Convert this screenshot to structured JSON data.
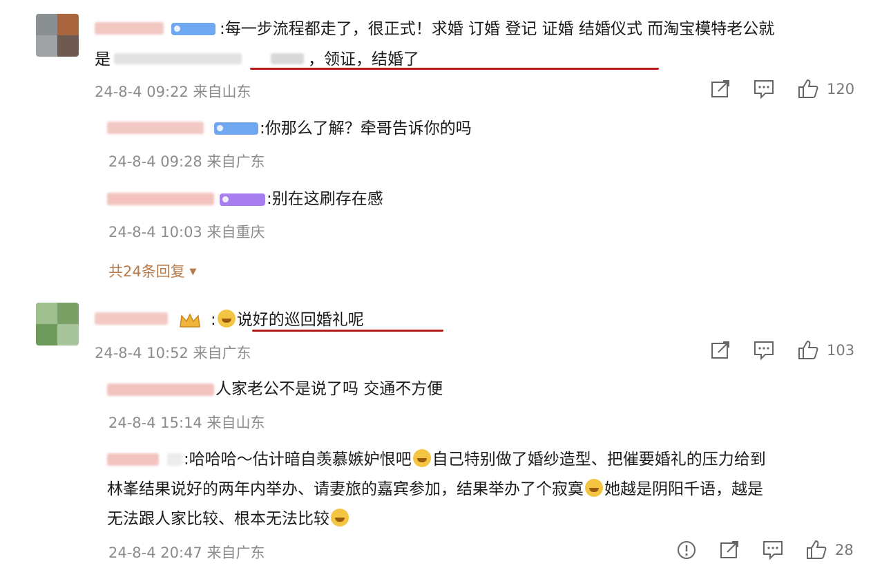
{
  "comments": [
    {
      "text_line1": ":每一步流程都走了，很正式！求婚 订婚 登记 证婚 结婚仪式 而淘宝模特老公就",
      "text_line2_prefix": "是",
      "text_line2_suffix": "，领证，结婚了",
      "timestamp": "24-8-4 09:22 来自山东",
      "likes": "120"
    },
    {
      "text": "说好的巡回婚礼呢",
      "timestamp": "24-8-4 10:52 来自广东",
      "likes": "103"
    }
  ],
  "replies": [
    {
      "text": ":你那么了解？牵哥告诉你的吗",
      "timestamp": "24-8-4 09:28 来自广东"
    },
    {
      "text": ":别在这刷存在感",
      "timestamp": "24-8-4 10:03 来自重庆"
    },
    {
      "text": "人家老公不是说了吗 交通不方便",
      "timestamp": "24-8-4 15:14 来自山东"
    },
    {
      "line1_a": ":哈哈哈～估计暗自羡慕嫉妒恨吧",
      "line1_b": "自己特别做了婚纱造型、把催要婚礼的压力给到",
      "line2_a": "林峯结果说好的两年内举办、请妻旅的嘉宾参加，结果举办了个寂寞",
      "line2_b": "她越是阴阳千语，越是",
      "line3": "无法跟人家比较、根本无法比较",
      "timestamp": "24-8-4 20:47 来自广东",
      "likes": "28"
    }
  ],
  "more_replies": "共24条回复",
  "colors": {
    "underline": "#b51a1a",
    "badge_blue": "#6fa8f0",
    "badge_purple": "#a77ef0",
    "more_link": "#b77a4a"
  },
  "icons": [
    "share-icon",
    "comment-icon",
    "like-icon",
    "report-icon",
    "crown-icon",
    "laugh-emoji-icon"
  ]
}
